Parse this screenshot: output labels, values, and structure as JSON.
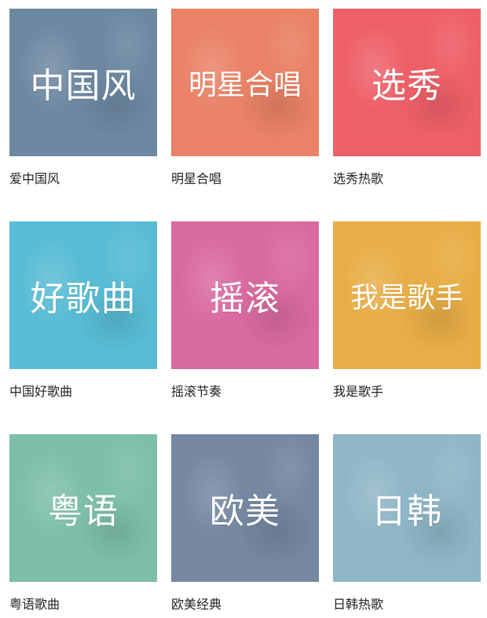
{
  "playlists": [
    {
      "tile_title": "中国风",
      "caption": "爱中国风",
      "color": "#6e88a2"
    },
    {
      "tile_title": "明星合唱",
      "caption": "明星合唱",
      "color": "#e98266"
    },
    {
      "tile_title": "选秀",
      "caption": "选秀热歌",
      "color": "#ee6068"
    },
    {
      "tile_title": "好歌曲",
      "caption": "中国好歌曲",
      "color": "#58bcd4"
    },
    {
      "tile_title": "摇滚",
      "caption": "摇滚节奏",
      "color": "#d96aa0"
    },
    {
      "tile_title": "我是歌手",
      "caption": "我是歌手",
      "color": "#e8ad46"
    },
    {
      "tile_title": "粤语",
      "caption": "粤语歌曲",
      "color": "#7dbfa9"
    },
    {
      "tile_title": "欧美",
      "caption": "欧美经典",
      "color": "#7587a1"
    },
    {
      "tile_title": "日韩",
      "caption": "日韩热歌",
      "color": "#8fb6c6"
    }
  ]
}
